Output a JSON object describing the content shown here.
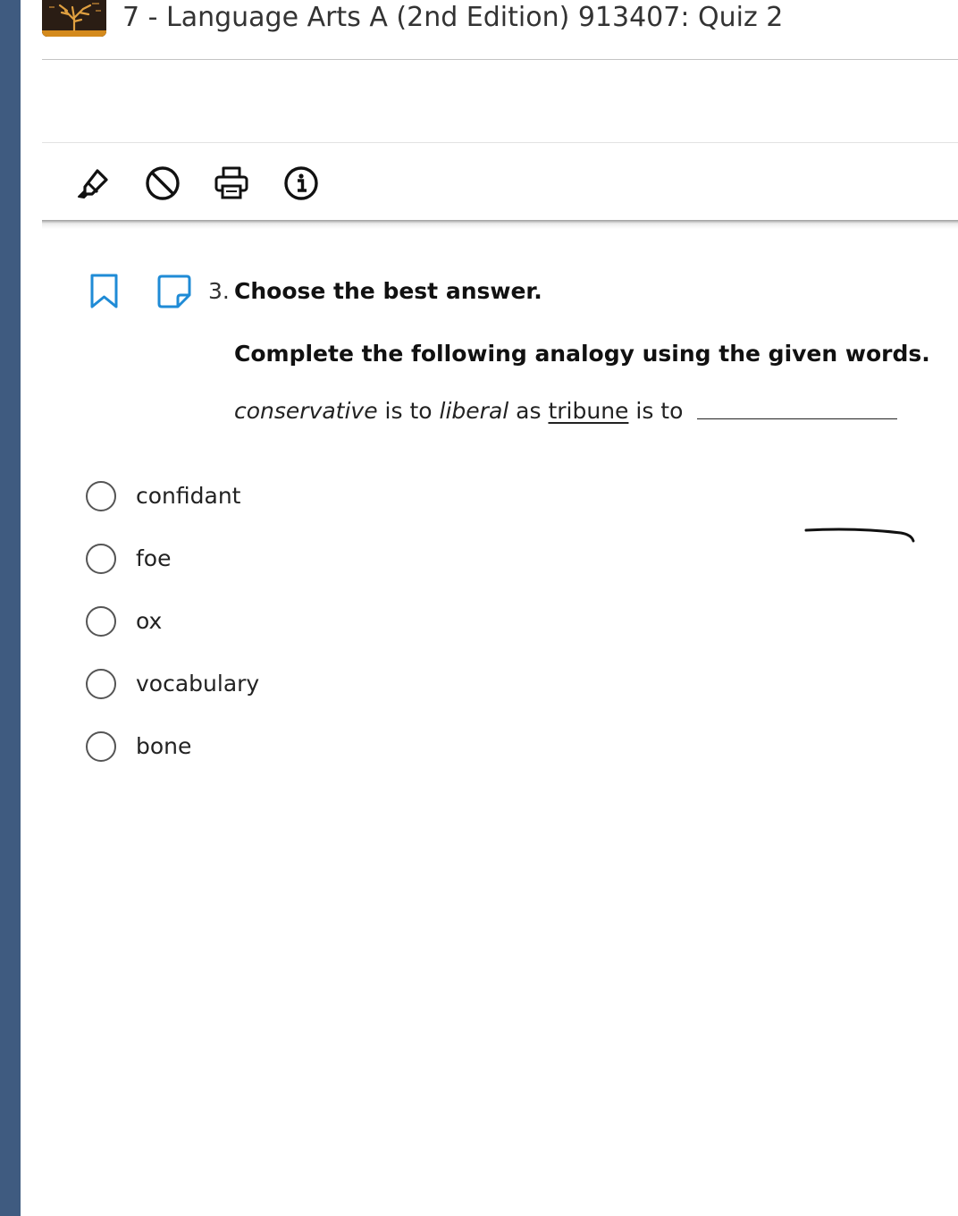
{
  "theme": {
    "rail": "#3f5b80",
    "accent": "#1f8bd6"
  },
  "header": {
    "title": "7 - Language Arts A (2nd Edition) 913407: Quiz 2",
    "logo_icon": "tree-logo"
  },
  "toolbar": {
    "tools": [
      {
        "name": "highlighter",
        "icon": "highlighter-icon"
      },
      {
        "name": "eliminate",
        "icon": "prohibit-icon"
      },
      {
        "name": "print",
        "icon": "printer-icon"
      },
      {
        "name": "info",
        "icon": "info-icon"
      }
    ]
  },
  "question": {
    "number": "3.",
    "prompt": "Choose the best answer.",
    "instruction": "Complete the following analogy using the given words.",
    "analogy": {
      "word1": "conservative",
      "connector1": " is to ",
      "word2": "liberal",
      "connector2": " as ",
      "word3": "tribune",
      "connector3": " is to "
    },
    "options": [
      "confidant",
      "foe",
      "ox",
      "vocabulary",
      "bone"
    ]
  }
}
